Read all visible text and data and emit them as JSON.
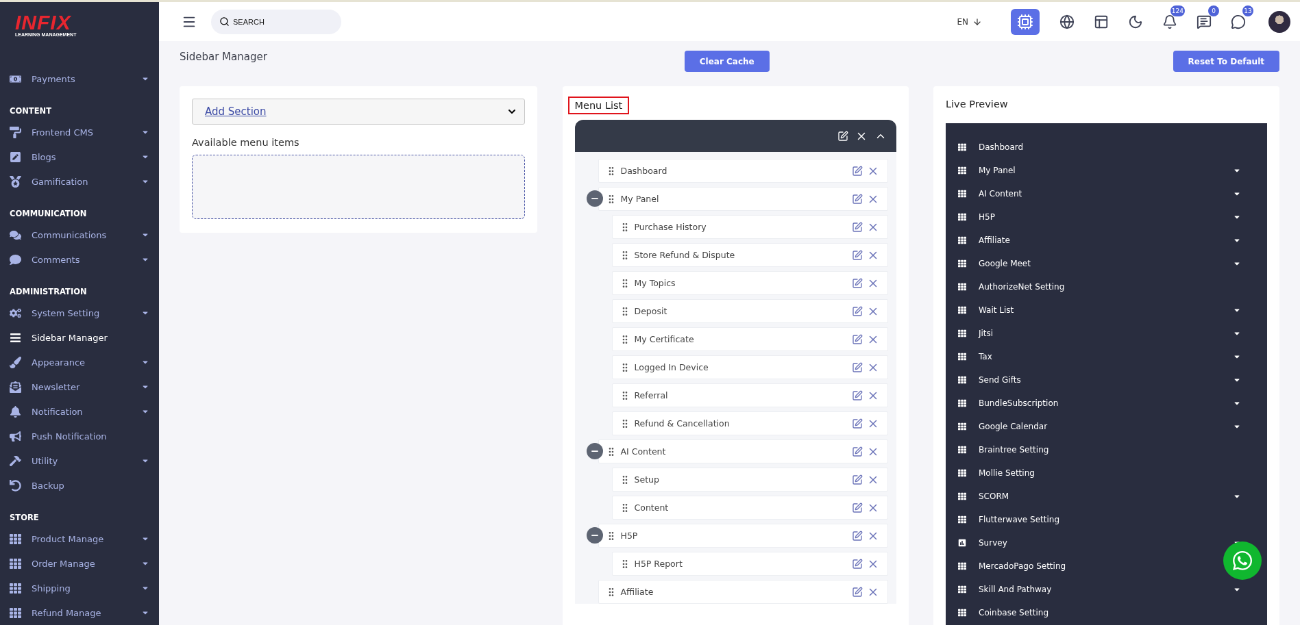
{
  "logo": {
    "brand": "INFIX",
    "tagline": "LEARNING MANAGEMENT"
  },
  "sidebar": [
    {
      "kind": "item",
      "label": "Payments",
      "caret": true,
      "selected": false
    },
    {
      "kind": "section",
      "label": "CONTENT"
    },
    {
      "kind": "item",
      "label": "Frontend CMS",
      "caret": true,
      "selected": false
    },
    {
      "kind": "item",
      "label": "Blogs",
      "caret": true,
      "selected": false
    },
    {
      "kind": "item",
      "label": "Gamification",
      "caret": true,
      "selected": false
    },
    {
      "kind": "section",
      "label": "COMMUNICATION"
    },
    {
      "kind": "item",
      "label": "Communications",
      "caret": true,
      "selected": false
    },
    {
      "kind": "item",
      "label": "Comments",
      "caret": true,
      "selected": false
    },
    {
      "kind": "section",
      "label": "ADMINISTRATION"
    },
    {
      "kind": "item",
      "label": "System Setting",
      "caret": true,
      "selected": false
    },
    {
      "kind": "item",
      "label": "Sidebar Manager",
      "caret": false,
      "selected": true
    },
    {
      "kind": "item",
      "label": "Appearance",
      "caret": true,
      "selected": false
    },
    {
      "kind": "item",
      "label": "Newsletter",
      "caret": true,
      "selected": false
    },
    {
      "kind": "item",
      "label": "Notification",
      "caret": true,
      "selected": false
    },
    {
      "kind": "item",
      "label": "Push Notification",
      "caret": false,
      "selected": false
    },
    {
      "kind": "item",
      "label": "Utility",
      "caret": true,
      "selected": false
    },
    {
      "kind": "item",
      "label": "Backup",
      "caret": false,
      "selected": false
    },
    {
      "kind": "section",
      "label": "STORE"
    },
    {
      "kind": "item",
      "label": "Product Manage",
      "caret": true,
      "selected": false
    },
    {
      "kind": "item",
      "label": "Order Manage",
      "caret": true,
      "selected": false
    },
    {
      "kind": "item",
      "label": "Shipping",
      "caret": true,
      "selected": false
    },
    {
      "kind": "item",
      "label": "Refund Manage",
      "caret": true,
      "selected": false
    }
  ],
  "topbar": {
    "search": {
      "placeholder": "SEARCH"
    },
    "language": "EN",
    "badges": {
      "notifications": "124",
      "messages": "0",
      "chats": "13"
    }
  },
  "page": {
    "title": "Sidebar Manager",
    "clear_button": "Clear Cache",
    "reset_button": "Reset To Default"
  },
  "left_panel": {
    "select": "Add Section",
    "available_title": "Available menu items"
  },
  "menu_list": {
    "title": "Menu List",
    "items": [
      {
        "label": "Dashboard"
      },
      {
        "label": "My Panel",
        "children": [
          {
            "label": "Purchase History"
          },
          {
            "label": "Store Refund & Dispute"
          },
          {
            "label": "My Topics"
          },
          {
            "label": "Deposit"
          },
          {
            "label": "My Certificate"
          },
          {
            "label": "Logged In Device"
          },
          {
            "label": "Referral"
          },
          {
            "label": "Refund & Cancellation"
          }
        ]
      },
      {
        "label": "AI Content",
        "children": [
          {
            "label": "Setup"
          },
          {
            "label": "Content"
          }
        ]
      },
      {
        "label": "H5P",
        "children": [
          {
            "label": "H5P Report"
          }
        ]
      },
      {
        "label": "Affiliate"
      }
    ]
  },
  "live_preview": {
    "title": "Live Preview",
    "items": [
      {
        "label": "Dashboard",
        "kind": "grid",
        "caret": false
      },
      {
        "label": "My Panel",
        "kind": "grid",
        "caret": true
      },
      {
        "label": "AI Content",
        "kind": "grid",
        "caret": true
      },
      {
        "label": "H5P",
        "kind": "grid",
        "caret": true
      },
      {
        "label": "Affiliate",
        "kind": "grid",
        "caret": true
      },
      {
        "label": "Google Meet",
        "kind": "grid",
        "caret": true
      },
      {
        "label": "AuthorizeNet Setting",
        "kind": "grid",
        "caret": false
      },
      {
        "label": "Wait List",
        "kind": "grid",
        "caret": true
      },
      {
        "label": "Jitsi",
        "kind": "grid",
        "caret": true
      },
      {
        "label": "Tax",
        "kind": "grid",
        "caret": true
      },
      {
        "label": "Send Gifts",
        "kind": "grid",
        "caret": true
      },
      {
        "label": "BundleSubscription",
        "kind": "grid",
        "caret": true
      },
      {
        "label": "Google Calendar",
        "kind": "grid",
        "caret": true
      },
      {
        "label": "Braintree Setting",
        "kind": "grid",
        "caret": false
      },
      {
        "label": "Mollie Setting",
        "kind": "grid",
        "caret": false
      },
      {
        "label": "SCORM",
        "kind": "grid",
        "caret": true
      },
      {
        "label": "Flutterwave Setting",
        "kind": "grid",
        "caret": false
      },
      {
        "label": "Survey",
        "kind": "form",
        "caret": true
      },
      {
        "label": "MercadoPago Setting",
        "kind": "grid",
        "caret": false
      },
      {
        "label": "Skill And Pathway",
        "kind": "grid",
        "caret": true
      },
      {
        "label": "Coinbase Setting",
        "kind": "grid",
        "caret": false
      }
    ]
  }
}
